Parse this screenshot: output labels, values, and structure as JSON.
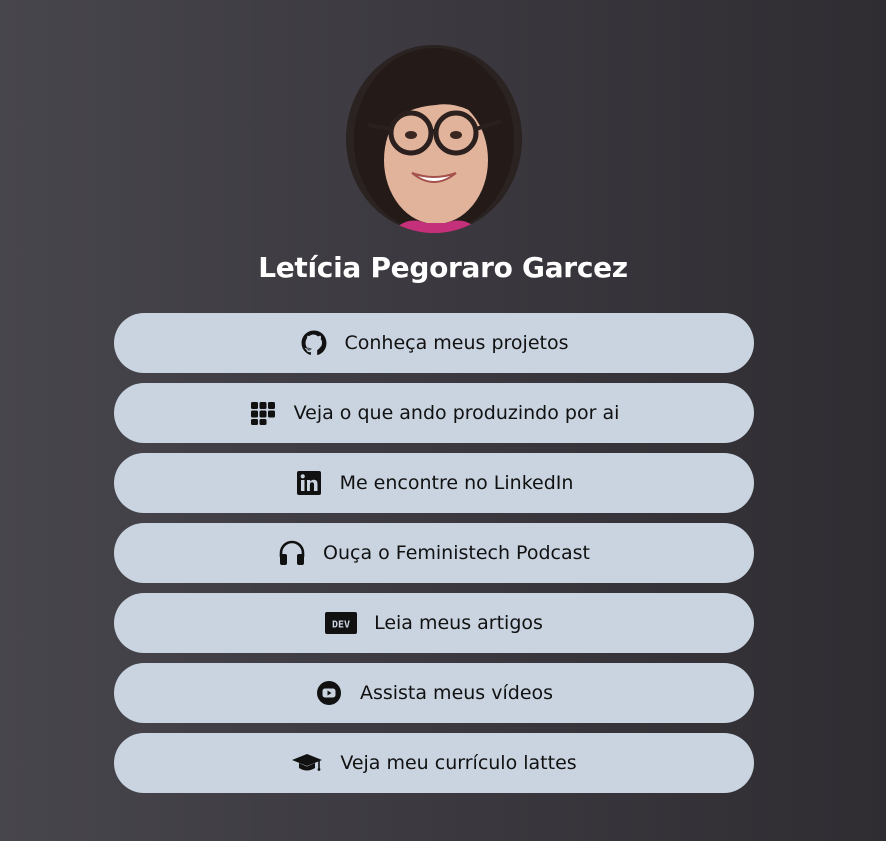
{
  "profile": {
    "name": "Letícia Pegoraro Garcez"
  },
  "links": [
    {
      "label": "Conheça meus projetos",
      "icon": "github-icon"
    },
    {
      "label": "Veja o que ando produzindo por ai",
      "icon": "grid-icon"
    },
    {
      "label": "Me encontre no LinkedIn",
      "icon": "linkedin-icon"
    },
    {
      "label": "Ouça o Feministech Podcast",
      "icon": "headphones-icon"
    },
    {
      "label": "Leia meus artigos",
      "icon": "dev-icon"
    },
    {
      "label": "Assista meus vídeos",
      "icon": "youtube-icon"
    },
    {
      "label": "Veja meu currículo lattes",
      "icon": "graduation-cap-icon"
    }
  ],
  "colors": {
    "button_bg": "#c9d4e0",
    "text_dark": "#111111",
    "name_text": "#ffffff"
  }
}
